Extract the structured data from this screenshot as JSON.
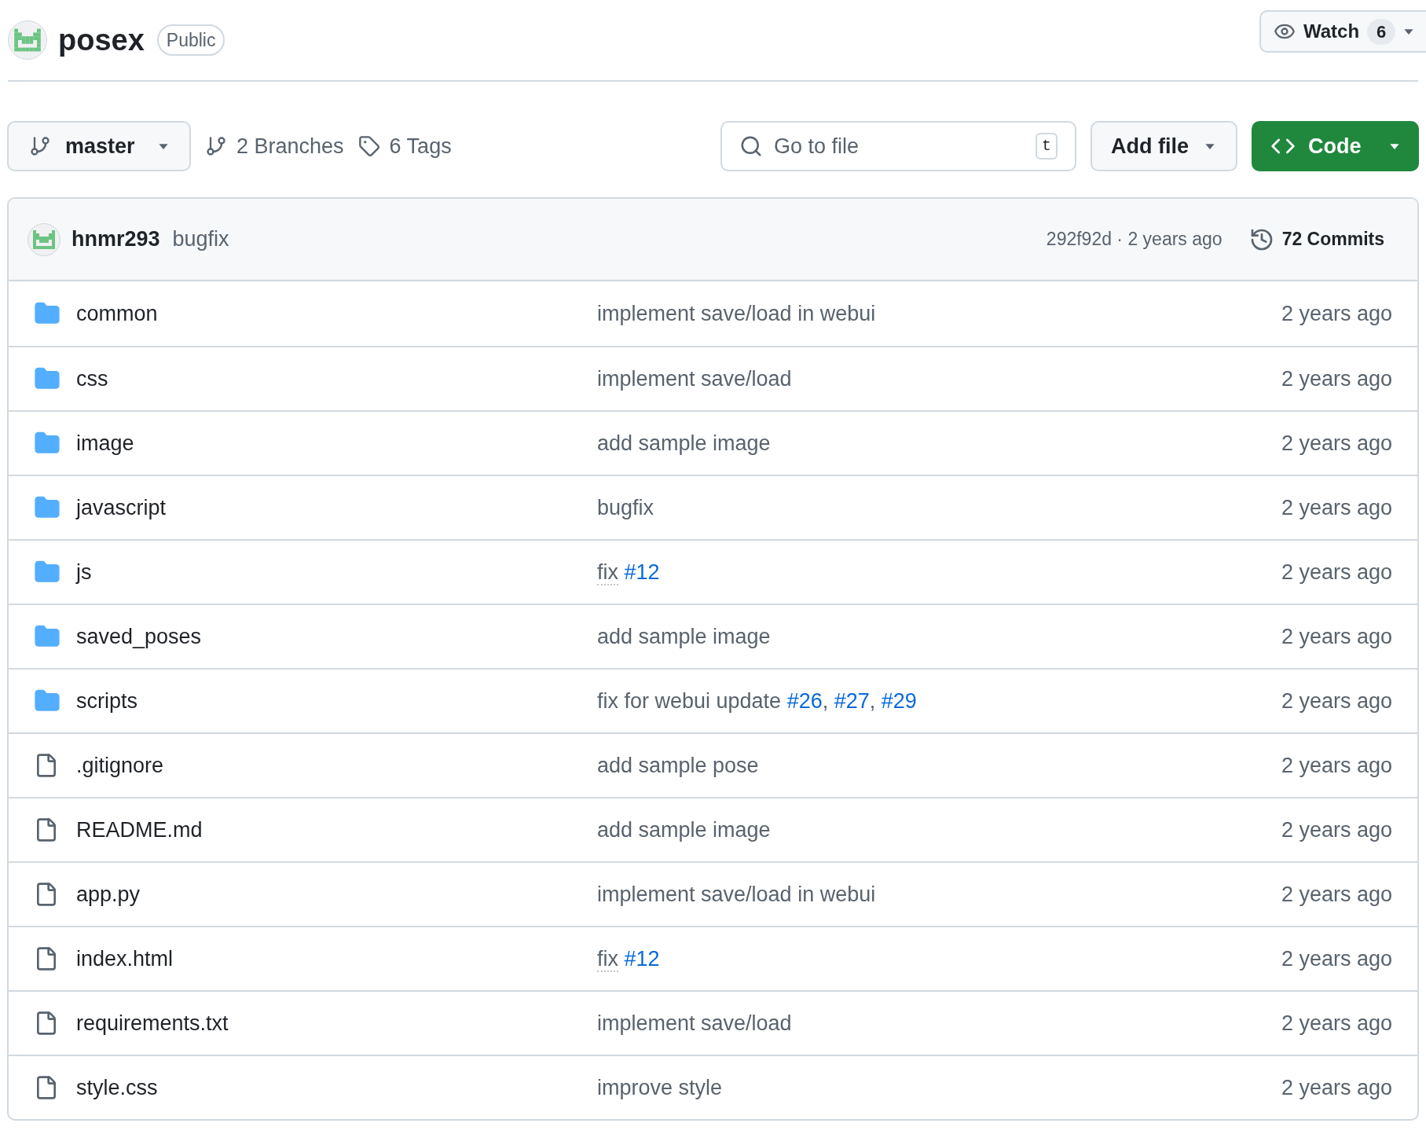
{
  "repo": {
    "name": "posex",
    "visibility": "Public"
  },
  "watch": {
    "label": "Watch",
    "count": "6"
  },
  "toolbar": {
    "branch": "master",
    "branches": "2 Branches",
    "tags": "6 Tags",
    "search": {
      "placeholder": "Go to file",
      "shortcut": "t"
    },
    "add_file": "Add file",
    "code": "Code"
  },
  "latest_commit": {
    "author": "hnmr293",
    "message": "bugfix",
    "hash_time": "292f92d · 2 years ago",
    "commits": "72 Commits"
  },
  "files": [
    {
      "kind": "folder",
      "name": "common",
      "message": [
        {
          "kind": "text",
          "text": "implement save/load in webui"
        }
      ],
      "time": "2 years ago"
    },
    {
      "kind": "folder",
      "name": "css",
      "message": [
        {
          "kind": "text",
          "text": "implement save/load"
        }
      ],
      "time": "2 years ago"
    },
    {
      "kind": "folder",
      "name": "image",
      "message": [
        {
          "kind": "text",
          "text": "add sample image"
        }
      ],
      "time": "2 years ago"
    },
    {
      "kind": "folder",
      "name": "javascript",
      "message": [
        {
          "kind": "text",
          "text": "bugfix"
        }
      ],
      "time": "2 years ago"
    },
    {
      "kind": "folder",
      "name": "js",
      "message": [
        {
          "kind": "dotted",
          "text": "fix "
        },
        {
          "kind": "link",
          "text": "#12"
        }
      ],
      "time": "2 years ago"
    },
    {
      "kind": "folder",
      "name": "saved_poses",
      "message": [
        {
          "kind": "text",
          "text": "add sample image"
        }
      ],
      "time": "2 years ago"
    },
    {
      "kind": "folder",
      "name": "scripts",
      "message": [
        {
          "kind": "text",
          "text": "fix for webui update "
        },
        {
          "kind": "link",
          "text": "#26"
        },
        {
          "kind": "text",
          "text": ", "
        },
        {
          "kind": "link",
          "text": "#27"
        },
        {
          "kind": "text",
          "text": ", "
        },
        {
          "kind": "link",
          "text": "#29"
        }
      ],
      "time": "2 years ago"
    },
    {
      "kind": "file",
      "name": ".gitignore",
      "message": [
        {
          "kind": "text",
          "text": "add sample pose"
        }
      ],
      "time": "2 years ago"
    },
    {
      "kind": "file",
      "name": "README.md",
      "message": [
        {
          "kind": "text",
          "text": "add sample image"
        }
      ],
      "time": "2 years ago"
    },
    {
      "kind": "file",
      "name": "app.py",
      "message": [
        {
          "kind": "text",
          "text": "implement save/load in webui"
        }
      ],
      "time": "2 years ago"
    },
    {
      "kind": "file",
      "name": "index.html",
      "message": [
        {
          "kind": "dotted",
          "text": "fix "
        },
        {
          "kind": "link",
          "text": "#12"
        }
      ],
      "time": "2 years ago"
    },
    {
      "kind": "file",
      "name": "requirements.txt",
      "message": [
        {
          "kind": "text",
          "text": "implement save/load"
        }
      ],
      "time": "2 years ago"
    },
    {
      "kind": "file",
      "name": "style.css",
      "message": [
        {
          "kind": "text",
          "text": "improve style"
        }
      ],
      "time": "2 years ago"
    }
  ]
}
